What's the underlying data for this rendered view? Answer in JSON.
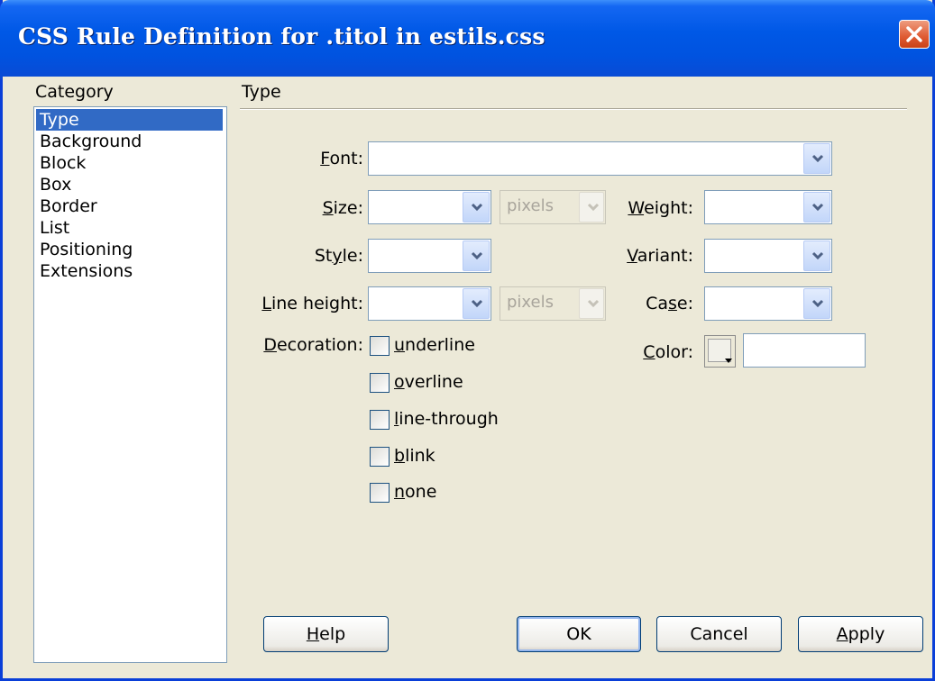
{
  "window": {
    "title": "CSS Rule Definition for .titol in estils.css"
  },
  "category": {
    "heading": "Category",
    "items": [
      "Type",
      "Background",
      "Block",
      "Box",
      "Border",
      "List",
      "Positioning",
      "Extensions"
    ],
    "selected": "Type"
  },
  "section": {
    "title": "Type"
  },
  "fields": {
    "font": {
      "prefix": "F",
      "rest": "ont:",
      "value": ""
    },
    "size": {
      "prefix": "S",
      "rest": "ize:",
      "value": "",
      "unit": "pixels"
    },
    "weight": {
      "prefix": "W",
      "rest": "eight:",
      "value": ""
    },
    "style": {
      "pre": "St",
      "u": "y",
      "rest": "le:",
      "value": ""
    },
    "variant": {
      "prefix": "V",
      "rest": "ariant:",
      "value": ""
    },
    "line_height": {
      "prefix": "L",
      "rest": "ine height:",
      "value": "",
      "unit": "pixels"
    },
    "case": {
      "pre": "Ca",
      "u": "s",
      "rest": "e:",
      "value": ""
    },
    "decoration": {
      "prefix": "D",
      "rest": "ecoration:"
    },
    "color": {
      "prefix": "C",
      "rest": "olor:",
      "value": ""
    }
  },
  "decorations": [
    {
      "prefix": "u",
      "rest": "nderline",
      "checked": false
    },
    {
      "prefix": "o",
      "rest": "verline",
      "checked": false
    },
    {
      "prefix": "l",
      "rest": "ine-through",
      "checked": false
    },
    {
      "prefix": "b",
      "rest": "link",
      "checked": false
    },
    {
      "prefix": "n",
      "rest": "one",
      "checked": false
    }
  ],
  "buttons": {
    "help": {
      "prefix": "H",
      "rest": "elp"
    },
    "ok": "OK",
    "cancel": "Cancel",
    "apply": {
      "prefix": "A",
      "rest": "pply"
    }
  },
  "icons": {
    "close": "close-icon",
    "dropdown": "chevron-down-icon",
    "color_picker": "color-picker-icon"
  },
  "colors": {
    "titlebar": "#0058e6",
    "selection": "#316ac5",
    "dialog_bg": "#ece9d8",
    "close_button": "#df5a32"
  }
}
